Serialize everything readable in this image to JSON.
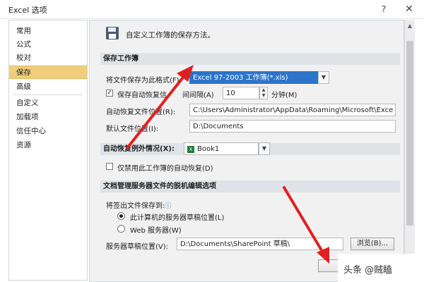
{
  "window": {
    "title": "Excel 选项",
    "help": "?",
    "close": "✕"
  },
  "sidebar": {
    "items": [
      {
        "label": "常用",
        "active": false
      },
      {
        "label": "公式",
        "active": false
      },
      {
        "label": "校对",
        "active": false
      },
      {
        "label": "保存",
        "active": true
      },
      {
        "label": "高级",
        "active": false
      },
      {
        "label": "自定义",
        "active": false
      },
      {
        "label": "加载项",
        "active": false
      },
      {
        "label": "信任中心",
        "active": false
      },
      {
        "label": "资源",
        "active": false
      }
    ]
  },
  "main": {
    "header": "自定义工作簿的保存方法。",
    "save_section": {
      "title": "保存工作簿",
      "format_label": "将文件保存为此格式(F):",
      "format_value": "Excel 97-2003 工作簿(*.xls)",
      "autorecover_label_a": "保存自动恢复信",
      "autorecover_label_b": "间间隔(A)",
      "autorecover_checked": "✓",
      "autorecover_minutes": "10",
      "minutes_label": "分钟(M)",
      "autorecover_location_label": "自动恢复文件位置(R):",
      "autorecover_location_value": "C:\\Users\\Administrator\\AppData\\Roaming\\Microsoft\\Exce",
      "default_location_label": "默认文件位置(I):",
      "default_location_value": "D:\\Documents"
    },
    "exceptions_section": {
      "title": "自动恢复例外情况(X):",
      "workbook": "Book1",
      "disable_label": "仅禁用此工作簿的自动恢复(D)"
    },
    "offline_section": {
      "title": "文档管理服务器文件的脱机编辑选项",
      "save_to_label": "将签出文件保存到:",
      "option1": "此计算机的服务器草稿位置(L)",
      "option2": "Web 服务器(W)",
      "drafts_label": "服务器草稿位置(V):",
      "drafts_value": "D:\\Documents\\SharePoint 草稿\\",
      "browse_button": "浏览(B)..."
    }
  },
  "watermark": "头条 @贼瞌",
  "colors": {
    "active_item": "#f3ce7a",
    "arrow": "#e02020",
    "selected_field": "#2c74c9"
  }
}
